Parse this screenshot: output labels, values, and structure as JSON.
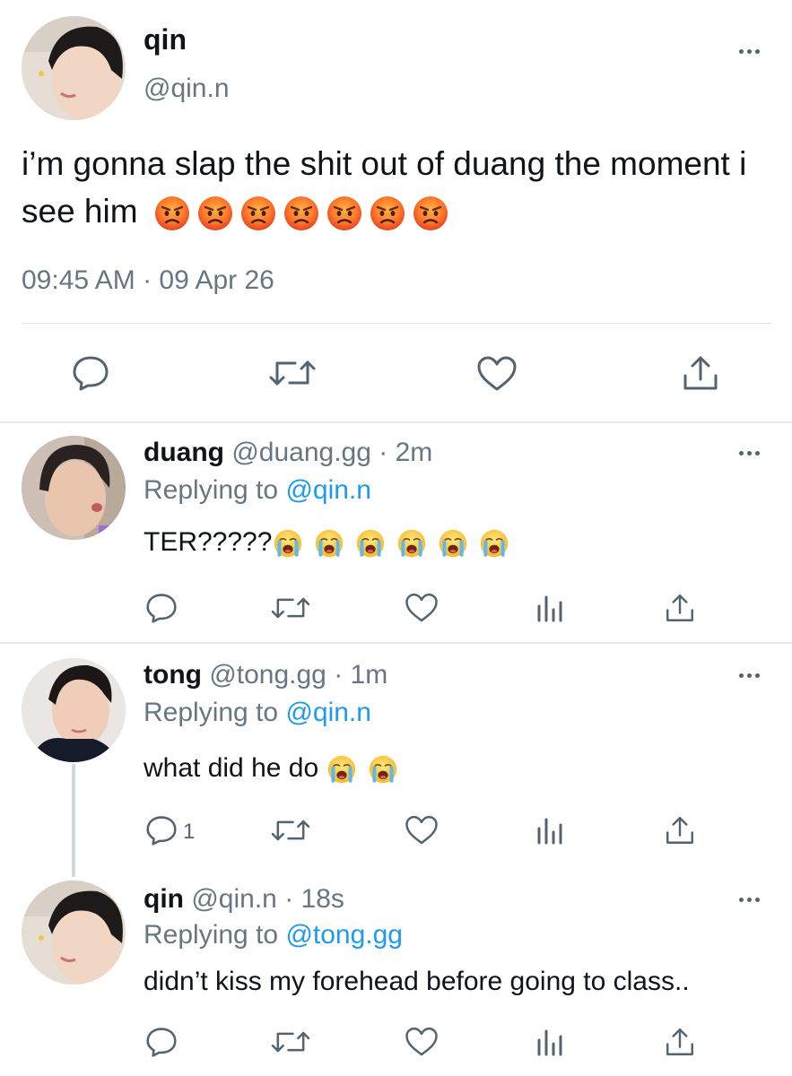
{
  "main_tweet": {
    "name": "qin",
    "handle": "@qin.n",
    "text": "i’m gonna slap the shit out of duang the moment i see him",
    "emojis": [
      "pouting-face-emoji",
      "pouting-face-emoji",
      "pouting-face-emoji",
      "pouting-face-emoji",
      "pouting-face-emoji",
      "pouting-face-emoji",
      "pouting-face-emoji"
    ],
    "timestamp": "09:45 AM · 09 Apr 26",
    "actions": [
      "reply-icon",
      "retweet-icon",
      "like-icon",
      "share-icon"
    ]
  },
  "replies": [
    {
      "name": "duang",
      "handle": "@duang.gg",
      "time": "2m",
      "replying_label": "Replying to",
      "replying_to": "@qin.n",
      "text": "TER?????",
      "emojis": [
        "loudly-crying-face-emoji",
        "loudly-crying-face-emoji",
        "loudly-crying-face-emoji",
        "loudly-crying-face-emoji",
        "loudly-crying-face-emoji",
        "loudly-crying-face-emoji"
      ],
      "reply_count": ""
    },
    {
      "name": "tong",
      "handle": "@tong.gg",
      "time": "1m",
      "replying_label": "Replying to",
      "replying_to": "@qin.n",
      "text": "what did he do",
      "emojis": [
        "loudly-crying-face-emoji",
        "loudly-crying-face-emoji"
      ],
      "reply_count": "1"
    },
    {
      "name": "qin",
      "handle": "@qin.n",
      "time": "18s",
      "replying_label": "Replying to",
      "replying_to": "@tong.gg",
      "text": "didn’t kiss my forehead before going to class..",
      "emojis": [],
      "reply_count": ""
    }
  ],
  "colors": {
    "link": "#1d9bf0",
    "muted": "#687684",
    "icon": "#536471",
    "divider": "#dfe3e6"
  }
}
